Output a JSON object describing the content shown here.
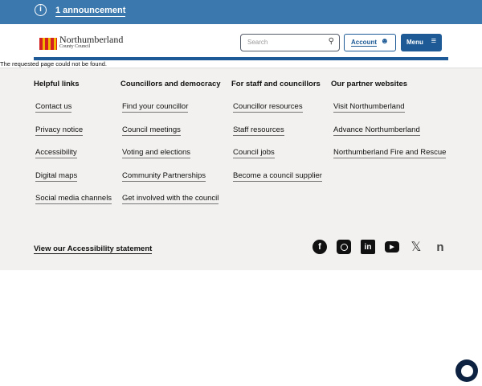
{
  "banner": {
    "announcement": "1 announcement"
  },
  "header": {
    "logo_name": "Northumberland",
    "logo_sub": "County Council",
    "search_placeholder": "Search",
    "account": "Account",
    "menu": "Menu"
  },
  "error": "The requested page could not be found.",
  "footer": {
    "columns": [
      {
        "heading": "Helpful links",
        "links": [
          "Contact us",
          "Privacy notice",
          "Accessibility",
          "Digital maps",
          "Social media channels"
        ]
      },
      {
        "heading": "Councillors and democracy",
        "links": [
          "Find your councillor",
          "Council meetings",
          "Voting and elections",
          "Community Partnerships",
          "Get involved with the council"
        ]
      },
      {
        "heading": "For staff and councillors",
        "links": [
          "Councillor resources",
          "Staff resources",
          "Council jobs",
          "Become a council supplier"
        ]
      },
      {
        "heading": "Our partner websites",
        "links": [
          "Visit Northumberland",
          "Advance Northumberland",
          "Northumberland Fire and Rescue"
        ]
      }
    ],
    "accessibility_statement": "View our Accessibility statement",
    "social": [
      "facebook",
      "instagram",
      "linkedin",
      "youtube",
      "x",
      "nextdoor"
    ]
  }
}
